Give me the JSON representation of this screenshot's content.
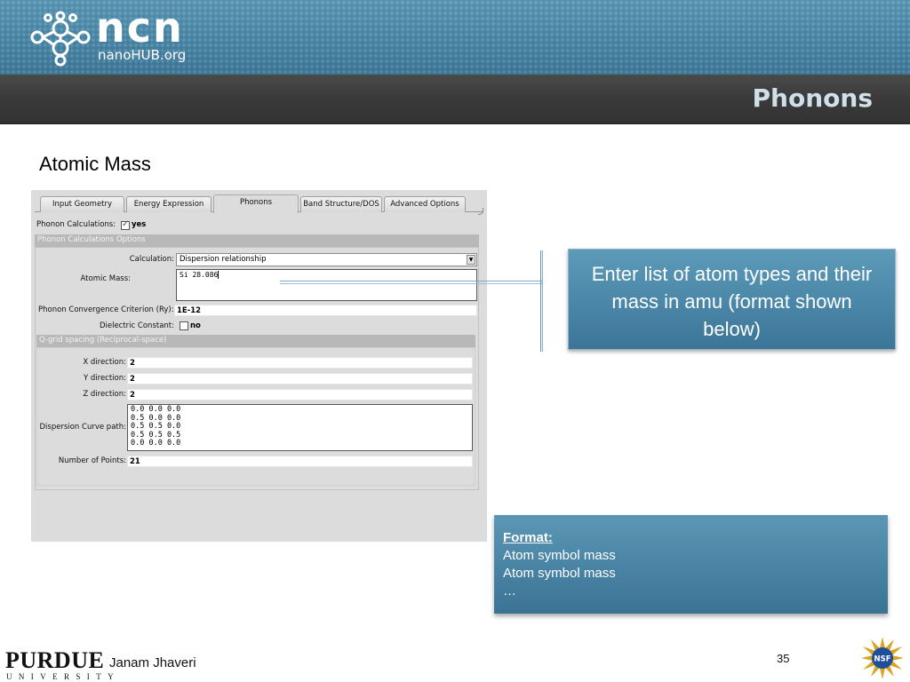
{
  "header": {
    "logo_text": "ncn",
    "logo_subtext": "nanoHUB.org",
    "title": "Phonons"
  },
  "subtitle": "Atomic Mass",
  "app": {
    "tabs": [
      {
        "label": "Input Geometry"
      },
      {
        "label": "Energy Expression"
      },
      {
        "label": "Phonons",
        "active": true
      },
      {
        "label": "Band Structure/DOS"
      },
      {
        "label": "Advanced Options"
      }
    ],
    "phonon_calc_label": "Phonon Calculations:",
    "phonon_calc_value": "yes",
    "options_header": "Phonon Calculations Options",
    "calculation_label": "Calculation:",
    "calculation_value": "Dispersion relationship",
    "atomic_mass_label": "Atomic Mass:",
    "atomic_mass_value": "Si 28.086",
    "convergence_label": "Phonon Convergence Criterion (Ry):",
    "convergence_value": "1E-12",
    "dielectric_label": "Dielectric Constant:",
    "dielectric_value": "no",
    "qgrid_header": "Q-grid spacing (Reciprocal-space)",
    "x_label": "X direction:",
    "x_value": "2",
    "y_label": "Y direction:",
    "y_value": "2",
    "z_label": "Z direction:",
    "z_value": "2",
    "dispersion_label": "Dispersion Curve path:",
    "dispersion_lines": [
      "0.0 0.0 0.0",
      "0.5 0.0 0.0",
      "0.5 0.5 0.0",
      "0.5 0.5 0.5",
      "0.0 0.0 0.0"
    ],
    "points_label": "Number of Points:",
    "points_value": "21"
  },
  "callout_main": {
    "text": "Enter list of atom types and their mass in amu (format shown below)"
  },
  "callout_format": {
    "title": "Format:",
    "lines": [
      "Atom symbol  mass",
      "Atom symbol  mass",
      "…"
    ]
  },
  "footer": {
    "university": "PURDUE",
    "university_sub": "UNIVERSITY",
    "author": "Janam Jhaveri",
    "page": "35",
    "nsf_text": "NSF"
  },
  "colors": {
    "header_blue": "#4a86a6",
    "header_bar": "#3a3a3a",
    "title_text": "#cfe0ea",
    "callout_blue": "#4a86a7"
  }
}
